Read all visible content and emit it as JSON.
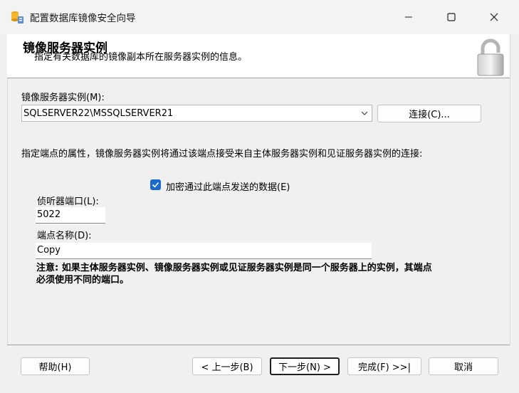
{
  "window": {
    "title": "配置数据库镜像安全向导",
    "app_icon": "database-wizard-icon",
    "controls": {
      "minimize": "minimize-icon",
      "maximize": "maximize-icon",
      "close": "close-icon"
    }
  },
  "header": {
    "title": "镜像服务器实例",
    "subtitle": "指定有关数据库的镜像副本所在服务器实例的信息。",
    "icon": "lock-icon"
  },
  "server": {
    "label": "镜像服务器实例(M):",
    "selected": "SQLSERVER22\\MSSQLSERVER21",
    "connect_label": "连接(C)..."
  },
  "endpoint": {
    "description": "指定端点的属性，镜像服务器实例将通过该端点接受来自主体服务器实例和见证服务器实例的连接:",
    "encrypt_label": "加密通过此端点发送的数据(E)",
    "encrypt_checked": true,
    "port_label": "侦听器端口(L):",
    "port_value": "5022",
    "name_label": "端点名称(D):",
    "name_value": "Copy",
    "note_line1": "注意: 如果主体服务器实例、镜像服务器实例或见证服务器实例是同一个服务器上的实例，其端点",
    "note_line2": "必须使用不同的端口。"
  },
  "footer": {
    "help": "帮助(H)",
    "back": "< 上一步(B)",
    "next": "下一步(N) >",
    "finish": "完成(F) >>|",
    "cancel": "取消"
  },
  "colors": {
    "accent": "#1b6ac9",
    "background": "#f0f0f0",
    "header": "#ffffff"
  }
}
